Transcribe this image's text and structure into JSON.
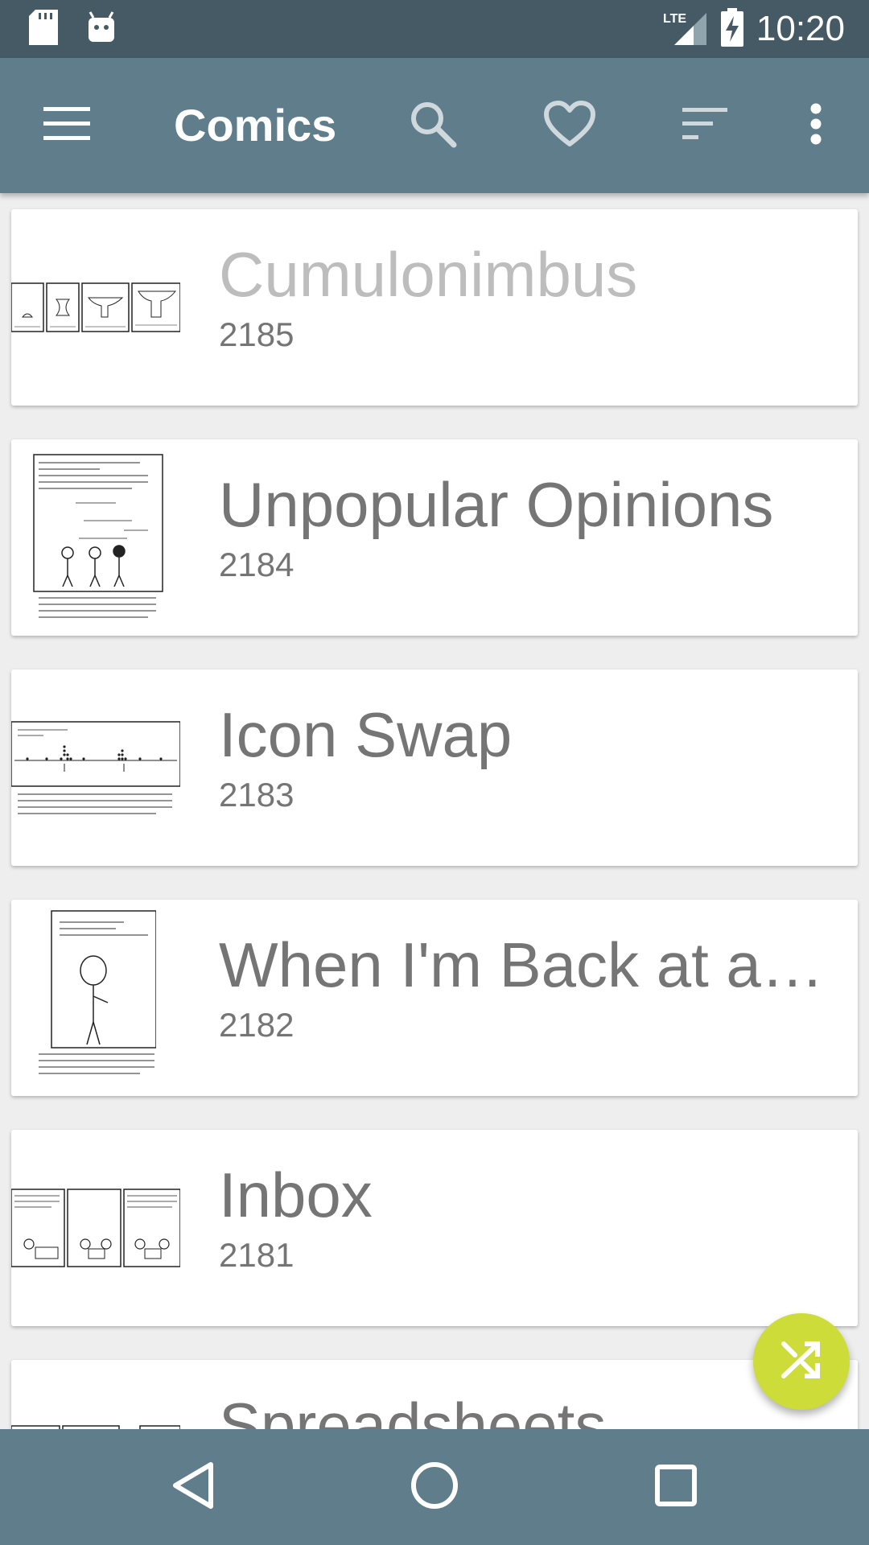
{
  "status_bar": {
    "time": "10:20",
    "network": "LTE",
    "icons": [
      "sd-card-icon",
      "android-icon",
      "lte-signal-icon",
      "battery-charging-icon"
    ]
  },
  "app_bar": {
    "title": "Comics",
    "icons": [
      "menu-icon",
      "search-icon",
      "heart-icon",
      "sort-icon",
      "more-vert-icon"
    ]
  },
  "comics": [
    {
      "title": "Cumulonimbus",
      "number": "2185",
      "read": true
    },
    {
      "title": "Unpopular Opinions",
      "number": "2184",
      "read": false
    },
    {
      "title": "Icon Swap",
      "number": "2183",
      "read": false
    },
    {
      "title": "When I'm Back at a…",
      "number": "2182",
      "read": false
    },
    {
      "title": "Inbox",
      "number": "2181",
      "read": false
    },
    {
      "title": "Spreadsheets",
      "number": "",
      "read": false
    }
  ],
  "fab": {
    "icon": "shuffle-icon"
  },
  "nav_bar": {
    "icons": [
      "back-icon",
      "home-icon",
      "recents-icon"
    ]
  },
  "colors": {
    "status_bar": "#455a64",
    "app_bar": "#607d8b",
    "fab": "#cddc39",
    "title_unread": "#757575",
    "title_read": "#bdbdbd"
  }
}
